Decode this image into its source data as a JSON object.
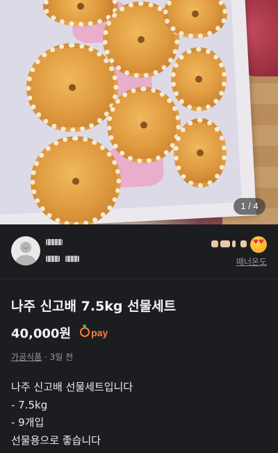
{
  "photo": {
    "counter": "1 / 4",
    "alt": "Nashinko pears in a gift box"
  },
  "seller": {
    "manner_label": "매너온도",
    "emoji_icon": "heart-eyes-emoji-icon"
  },
  "product": {
    "title": "나주 신고배 7.5kg 선물세트",
    "price": "40,000원",
    "pay_label": "pay",
    "category": "가공식품",
    "separator": " · ",
    "posted": "3일 전",
    "description": [
      "나주 신고배 선물세트입니다",
      "- 7.5kg",
      "- 9개입",
      "선물용으로 좋습니다"
    ]
  },
  "colors": {
    "background": "#1c1d21",
    "accent": "#ff7e36",
    "muted": "#9a9ba0"
  }
}
